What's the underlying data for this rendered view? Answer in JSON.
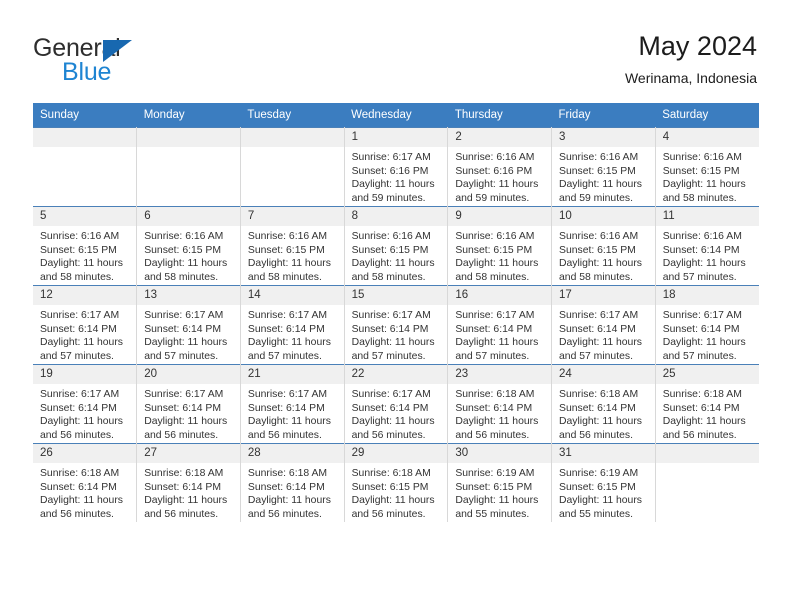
{
  "brand": {
    "name_part1": "General",
    "name_part2": "Blue",
    "accent_color": "#1e84d2",
    "logo_triangle_color": "#1868b0"
  },
  "header": {
    "title": "May 2024",
    "subtitle": "Werinama, Indonesia"
  },
  "calendar": {
    "header_bg": "#3b7dc0",
    "header_text_color": "#ffffff",
    "daynum_bg": "#f0f0f0",
    "weekday_headers": [
      "Sunday",
      "Monday",
      "Tuesday",
      "Wednesday",
      "Thursday",
      "Friday",
      "Saturday"
    ],
    "weeks": [
      [
        {
          "day": "",
          "empty": true
        },
        {
          "day": "",
          "empty": true
        },
        {
          "day": "",
          "empty": true
        },
        {
          "day": "1",
          "sunrise": "Sunrise: 6:17 AM",
          "sunset": "Sunset: 6:16 PM",
          "daylight1": "Daylight: 11 hours",
          "daylight2": "and 59 minutes."
        },
        {
          "day": "2",
          "sunrise": "Sunrise: 6:16 AM",
          "sunset": "Sunset: 6:16 PM",
          "daylight1": "Daylight: 11 hours",
          "daylight2": "and 59 minutes."
        },
        {
          "day": "3",
          "sunrise": "Sunrise: 6:16 AM",
          "sunset": "Sunset: 6:15 PM",
          "daylight1": "Daylight: 11 hours",
          "daylight2": "and 59 minutes."
        },
        {
          "day": "4",
          "sunrise": "Sunrise: 6:16 AM",
          "sunset": "Sunset: 6:15 PM",
          "daylight1": "Daylight: 11 hours",
          "daylight2": "and 58 minutes."
        }
      ],
      [
        {
          "day": "5",
          "sunrise": "Sunrise: 6:16 AM",
          "sunset": "Sunset: 6:15 PM",
          "daylight1": "Daylight: 11 hours",
          "daylight2": "and 58 minutes."
        },
        {
          "day": "6",
          "sunrise": "Sunrise: 6:16 AM",
          "sunset": "Sunset: 6:15 PM",
          "daylight1": "Daylight: 11 hours",
          "daylight2": "and 58 minutes."
        },
        {
          "day": "7",
          "sunrise": "Sunrise: 6:16 AM",
          "sunset": "Sunset: 6:15 PM",
          "daylight1": "Daylight: 11 hours",
          "daylight2": "and 58 minutes."
        },
        {
          "day": "8",
          "sunrise": "Sunrise: 6:16 AM",
          "sunset": "Sunset: 6:15 PM",
          "daylight1": "Daylight: 11 hours",
          "daylight2": "and 58 minutes."
        },
        {
          "day": "9",
          "sunrise": "Sunrise: 6:16 AM",
          "sunset": "Sunset: 6:15 PM",
          "daylight1": "Daylight: 11 hours",
          "daylight2": "and 58 minutes."
        },
        {
          "day": "10",
          "sunrise": "Sunrise: 6:16 AM",
          "sunset": "Sunset: 6:15 PM",
          "daylight1": "Daylight: 11 hours",
          "daylight2": "and 58 minutes."
        },
        {
          "day": "11",
          "sunrise": "Sunrise: 6:16 AM",
          "sunset": "Sunset: 6:14 PM",
          "daylight1": "Daylight: 11 hours",
          "daylight2": "and 57 minutes."
        }
      ],
      [
        {
          "day": "12",
          "sunrise": "Sunrise: 6:17 AM",
          "sunset": "Sunset: 6:14 PM",
          "daylight1": "Daylight: 11 hours",
          "daylight2": "and 57 minutes."
        },
        {
          "day": "13",
          "sunrise": "Sunrise: 6:17 AM",
          "sunset": "Sunset: 6:14 PM",
          "daylight1": "Daylight: 11 hours",
          "daylight2": "and 57 minutes."
        },
        {
          "day": "14",
          "sunrise": "Sunrise: 6:17 AM",
          "sunset": "Sunset: 6:14 PM",
          "daylight1": "Daylight: 11 hours",
          "daylight2": "and 57 minutes."
        },
        {
          "day": "15",
          "sunrise": "Sunrise: 6:17 AM",
          "sunset": "Sunset: 6:14 PM",
          "daylight1": "Daylight: 11 hours",
          "daylight2": "and 57 minutes."
        },
        {
          "day": "16",
          "sunrise": "Sunrise: 6:17 AM",
          "sunset": "Sunset: 6:14 PM",
          "daylight1": "Daylight: 11 hours",
          "daylight2": "and 57 minutes."
        },
        {
          "day": "17",
          "sunrise": "Sunrise: 6:17 AM",
          "sunset": "Sunset: 6:14 PM",
          "daylight1": "Daylight: 11 hours",
          "daylight2": "and 57 minutes."
        },
        {
          "day": "18",
          "sunrise": "Sunrise: 6:17 AM",
          "sunset": "Sunset: 6:14 PM",
          "daylight1": "Daylight: 11 hours",
          "daylight2": "and 57 minutes."
        }
      ],
      [
        {
          "day": "19",
          "sunrise": "Sunrise: 6:17 AM",
          "sunset": "Sunset: 6:14 PM",
          "daylight1": "Daylight: 11 hours",
          "daylight2": "and 56 minutes."
        },
        {
          "day": "20",
          "sunrise": "Sunrise: 6:17 AM",
          "sunset": "Sunset: 6:14 PM",
          "daylight1": "Daylight: 11 hours",
          "daylight2": "and 56 minutes."
        },
        {
          "day": "21",
          "sunrise": "Sunrise: 6:17 AM",
          "sunset": "Sunset: 6:14 PM",
          "daylight1": "Daylight: 11 hours",
          "daylight2": "and 56 minutes."
        },
        {
          "day": "22",
          "sunrise": "Sunrise: 6:17 AM",
          "sunset": "Sunset: 6:14 PM",
          "daylight1": "Daylight: 11 hours",
          "daylight2": "and 56 minutes."
        },
        {
          "day": "23",
          "sunrise": "Sunrise: 6:18 AM",
          "sunset": "Sunset: 6:14 PM",
          "daylight1": "Daylight: 11 hours",
          "daylight2": "and 56 minutes."
        },
        {
          "day": "24",
          "sunrise": "Sunrise: 6:18 AM",
          "sunset": "Sunset: 6:14 PM",
          "daylight1": "Daylight: 11 hours",
          "daylight2": "and 56 minutes."
        },
        {
          "day": "25",
          "sunrise": "Sunrise: 6:18 AM",
          "sunset": "Sunset: 6:14 PM",
          "daylight1": "Daylight: 11 hours",
          "daylight2": "and 56 minutes."
        }
      ],
      [
        {
          "day": "26",
          "sunrise": "Sunrise: 6:18 AM",
          "sunset": "Sunset: 6:14 PM",
          "daylight1": "Daylight: 11 hours",
          "daylight2": "and 56 minutes."
        },
        {
          "day": "27",
          "sunrise": "Sunrise: 6:18 AM",
          "sunset": "Sunset: 6:14 PM",
          "daylight1": "Daylight: 11 hours",
          "daylight2": "and 56 minutes."
        },
        {
          "day": "28",
          "sunrise": "Sunrise: 6:18 AM",
          "sunset": "Sunset: 6:14 PM",
          "daylight1": "Daylight: 11 hours",
          "daylight2": "and 56 minutes."
        },
        {
          "day": "29",
          "sunrise": "Sunrise: 6:18 AM",
          "sunset": "Sunset: 6:15 PM",
          "daylight1": "Daylight: 11 hours",
          "daylight2": "and 56 minutes."
        },
        {
          "day": "30",
          "sunrise": "Sunrise: 6:19 AM",
          "sunset": "Sunset: 6:15 PM",
          "daylight1": "Daylight: 11 hours",
          "daylight2": "and 55 minutes."
        },
        {
          "day": "31",
          "sunrise": "Sunrise: 6:19 AM",
          "sunset": "Sunset: 6:15 PM",
          "daylight1": "Daylight: 11 hours",
          "daylight2": "and 55 minutes."
        },
        {
          "day": "",
          "empty": true
        }
      ]
    ]
  }
}
